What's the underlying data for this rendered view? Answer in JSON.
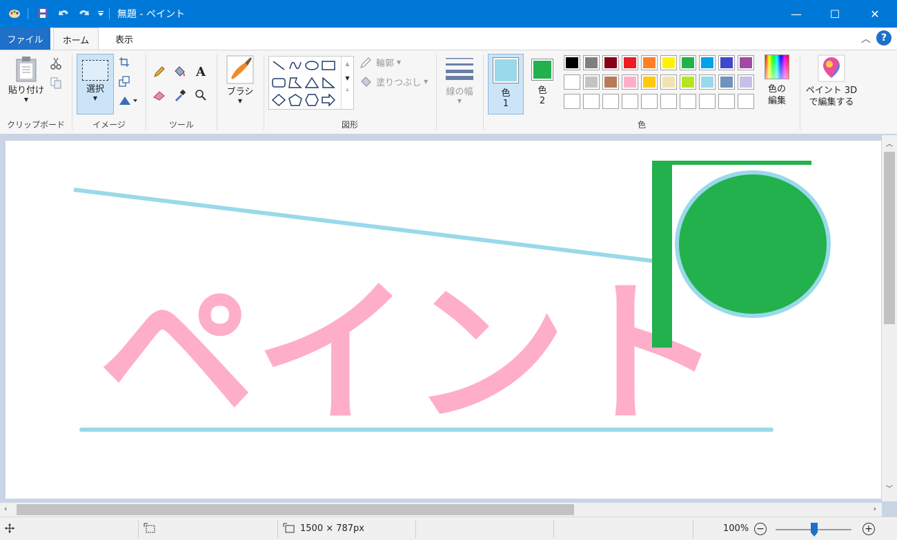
{
  "window": {
    "title": "無題 - ペイント",
    "minimize": "—",
    "maximize": "☐",
    "close": "✕"
  },
  "tabs": {
    "file": "ファイル",
    "home": "ホーム",
    "view": "表示",
    "help": "?"
  },
  "ribbon": {
    "clipboard": {
      "paste": "貼り付け",
      "label": "クリップボード"
    },
    "image": {
      "select": "選択",
      "label": "イメージ"
    },
    "tools": {
      "label": "ツール"
    },
    "brushes": {
      "label": "ブラシ"
    },
    "shapes": {
      "outline": "輪郭",
      "fill": "塗りつぶし",
      "label": "図形"
    },
    "size": {
      "label": "線の幅"
    },
    "colors": {
      "color1_label": "色",
      "color1_num": "1",
      "color2_label": "色",
      "color2_num": "2",
      "edit_line1": "色の",
      "edit_line2": "編集",
      "label": "色",
      "color1": "#99d9ea",
      "color2": "#22b14c",
      "palette_row1": [
        "#000000",
        "#7f7f7f",
        "#880015",
        "#ed1c24",
        "#ff7f27",
        "#fff200",
        "#22b14c",
        "#00a2e8",
        "#3f48cc",
        "#a349a4"
      ],
      "palette_row2": [
        "#ffffff",
        "#c3c3c3",
        "#b97a57",
        "#ffaec9",
        "#ffc90e",
        "#efe4b0",
        "#b5e61d",
        "#99d9ea",
        "#7092be",
        "#c8bfe7"
      ]
    },
    "paint3d": {
      "line1": "ペイント 3D",
      "line2": "で編集する"
    }
  },
  "canvas": {
    "text": "ペイント",
    "text_color": "#ffaec9",
    "line_color": "#99d9ea",
    "green": "#22b14c"
  },
  "status": {
    "size": "1500 × 787px",
    "zoom": "100%"
  }
}
